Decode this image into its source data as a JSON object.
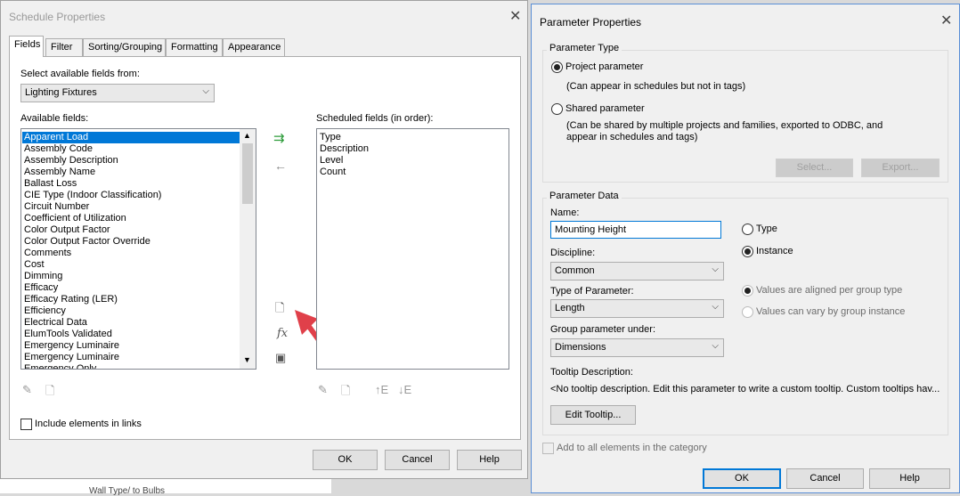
{
  "schedule_dialog": {
    "title": "Schedule Properties",
    "tabs": [
      "Fields",
      "Filter",
      "Sorting/Grouping",
      "Formatting",
      "Appearance"
    ],
    "select_from_label": "Select available fields from:",
    "category_value": "Lighting Fixtures",
    "available_label": "Available fields:",
    "available_fields": [
      "Apparent Load",
      "Assembly Code",
      "Assembly Description",
      "Assembly Name",
      "Ballast Loss",
      "CIE Type (Indoor Classification)",
      "Circuit Number",
      "Coefficient of Utilization",
      "Color Output Factor",
      "Color Output Factor Override",
      "Comments",
      "Cost",
      "Dimming",
      "Efficacy",
      "Efficacy Rating (LER)",
      "Efficiency",
      "Electrical Data",
      "ElumTools Validated",
      "Emergency Luminaire",
      "Emergency Luminaire",
      "Emergency Only"
    ],
    "scheduled_label": "Scheduled fields (in order):",
    "scheduled_fields": [
      "Type",
      "Description",
      "Level",
      "Count"
    ],
    "include_links_label": "Include elements in links",
    "ok": "OK",
    "cancel": "Cancel",
    "help": "Help",
    "arrow_color": "#e0404a"
  },
  "param_dialog": {
    "title": "Parameter Properties",
    "type_group": "Parameter Type",
    "project_param": "Project parameter",
    "project_param_note": "(Can appear in schedules but not in tags)",
    "shared_param": "Shared parameter",
    "shared_param_note_1": "(Can be shared by multiple projects and families, exported to ODBC, and",
    "shared_param_note_2": "appear in schedules and tags)",
    "select_btn": "Select...",
    "export_btn": "Export...",
    "data_group": "Parameter Data",
    "name_label": "Name:",
    "name_value": "Mounting Height",
    "type_radio": "Type",
    "instance_radio": "Instance",
    "discipline_label": "Discipline:",
    "discipline_value": "Common",
    "param_type_label": "Type of Parameter:",
    "param_type_value": "Length",
    "aligned_radio": "Values are aligned per group type",
    "vary_radio": "Values can vary by group instance",
    "group_under_label": "Group parameter under:",
    "group_under_value": "Dimensions",
    "tooltip_label": "Tooltip Description:",
    "tooltip_text": "<No tooltip description. Edit this parameter to write a custom tooltip. Custom tooltips hav...",
    "edit_tooltip_btn": "Edit Tooltip...",
    "add_all_label": "Add to all elements in the category",
    "ok": "OK",
    "cancel": "Cancel",
    "help": "Help"
  },
  "background_text": "Wall Type/ to Bulbs"
}
